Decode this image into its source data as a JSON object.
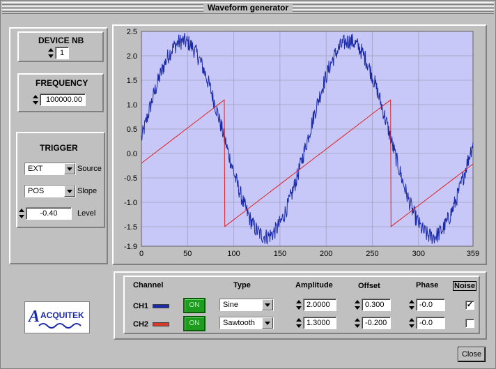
{
  "window": {
    "title": "Waveform generator"
  },
  "device": {
    "label": "DEVICE NB",
    "value": "1"
  },
  "frequency": {
    "label": "FREQUENCY",
    "value": "100000.00"
  },
  "trigger": {
    "label": "TRIGGER",
    "source_value": "EXT",
    "source_label": "Source",
    "slope_value": "POS",
    "slope_label": "Slope",
    "level_value": "-0.40",
    "level_label": "Level"
  },
  "table": {
    "headers": {
      "channel": "Channel",
      "type": "Type",
      "amplitude": "Amplitude",
      "offset": "Offset",
      "phase": "Phase",
      "noise": "Noise"
    },
    "rows": [
      {
        "name": "CH1",
        "color": "#1a2aa8",
        "state": "ON",
        "type": "Sine",
        "amplitude": "2.0000",
        "offset": "0.300",
        "phase": "-0.0",
        "noise": "✓"
      },
      {
        "name": "CH2",
        "color": "#d83a2a",
        "state": "ON",
        "type": "Sawtooth",
        "amplitude": "1.3000",
        "offset": "-0.200",
        "phase": "-0.0",
        "noise": ""
      }
    ]
  },
  "logo": {
    "text": "ACQUITEK"
  },
  "close_label": "Close",
  "colors": {
    "plot_bg": "#c8c8f8",
    "grid": "#a8a8c8",
    "ch1": "#1a2aa8",
    "ch2": "#e02020",
    "window_bg": "#c0c0c0"
  },
  "chart_data": {
    "type": "line",
    "title": "",
    "xlabel": "",
    "ylabel": "",
    "xlim": [
      0,
      359
    ],
    "ylim": [
      -1.9,
      2.5
    ],
    "x_ticks": [
      "0",
      "50",
      "100",
      "150",
      "200",
      "250",
      "300",
      "359"
    ],
    "y_ticks": [
      "2.5",
      "2.0",
      "1.5",
      "1.0",
      "0.5",
      "0.0",
      "-0.5",
      "-1.0",
      "-1.5",
      "-1.9"
    ],
    "grid": true,
    "series": [
      {
        "waveform": "sine",
        "amplitude": 2.0,
        "offset": 0.3,
        "cycles": 2,
        "noise": true
      },
      {
        "waveform": "sawtooth",
        "amplitude": 1.3,
        "offset": -0.2,
        "cycles": 2,
        "noise": false
      }
    ]
  }
}
